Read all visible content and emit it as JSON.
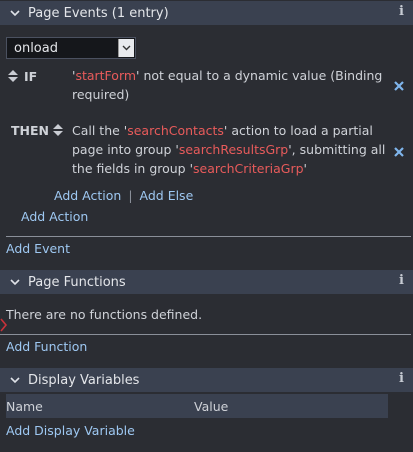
{
  "page_events": {
    "title": "Page Events (1 entry)",
    "event_select": {
      "value": "onload"
    },
    "if_label": "IF",
    "if_text_pre": "'",
    "if_value": "startForm",
    "if_text_post": "' not equal to a dynamic value (Binding required)",
    "then_label": "THEN",
    "then_text_1": "Call the '",
    "then_action": "searchContacts",
    "then_text_2": "' action to load a partial page into group '",
    "then_group": "searchResultsGrp",
    "then_text_3": "', submitting all the fields in group '",
    "then_fields": "searchCriteriaGrp",
    "then_text_4": "'",
    "add_action_inner": "Add Action",
    "divider": "|",
    "add_else": "Add Else",
    "add_action_outer": "Add Action",
    "add_event": "Add Event"
  },
  "page_functions": {
    "title": "Page Functions",
    "empty_text": "There are no functions defined.",
    "add_function": "Add Function"
  },
  "display_variables": {
    "title": "Display Variables",
    "columns": [
      "Name",
      "Value"
    ],
    "add_display_variable": "Add Display Variable"
  },
  "colors": {
    "header_bg": "#3a4150",
    "body_bg": "#2b2d33",
    "link": "#9ec8f2",
    "highlight": "#e85b5b",
    "remove_icon": "#7fb5ec"
  },
  "icons": [
    "chevron-down-icon",
    "info-icon",
    "sort-updown-icon",
    "remove-x-icon",
    "select-arrow-icon",
    "side-marker-icon"
  ]
}
